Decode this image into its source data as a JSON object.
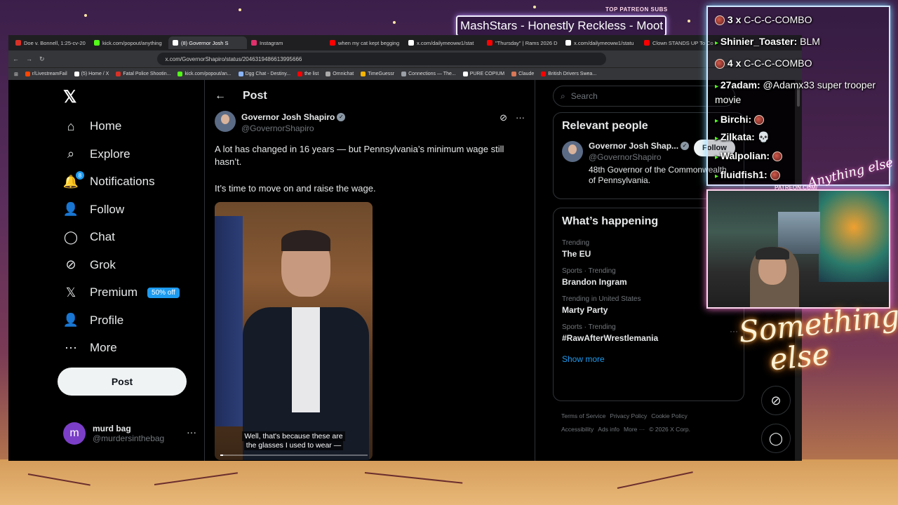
{
  "browser": {
    "tabs": [
      {
        "label": "Doe v. Bonnell, 1:25-cv-20",
        "color": "#d93025",
        "active": false
      },
      {
        "label": "kick.com/popout/anything",
        "color": "#53fc18",
        "active": false
      },
      {
        "label": "(8) Governor Josh S",
        "color": "#ffffff",
        "active": true
      },
      {
        "label": "Instagram",
        "color": "#e1306c",
        "active": false
      },
      {
        "label": "when my cat kept begging",
        "color": "#ff0000",
        "active": false
      },
      {
        "label": "x.com/dailymeoww1/stat",
        "color": "#ffffff",
        "active": false
      },
      {
        "label": "\"Thursday\" | Rams 2026 D",
        "color": "#ff0000",
        "active": false
      },
      {
        "label": "x.com/dailymeoww1/statu",
        "color": "#ffffff",
        "active": false
      },
      {
        "label": "Clown STANDS UP To Co",
        "color": "#ff0000",
        "active": false
      }
    ],
    "url": "x.com/GovernorShapiro/status/2046319486613995666",
    "bookmarks": [
      {
        "label": "r/LivestreamFail",
        "color": "#ff4500"
      },
      {
        "label": "(5) Home / X",
        "color": "#ffffff"
      },
      {
        "label": "Fatal Police Shootin...",
        "color": "#d93025"
      },
      {
        "label": "kick.com/popout/an...",
        "color": "#53fc18"
      },
      {
        "label": "Dgg Chat - Destiny...",
        "color": "#8ab4f8"
      },
      {
        "label": "the list",
        "color": "#ff0000"
      },
      {
        "label": "Omnichat",
        "color": "#aaaaaa"
      },
      {
        "label": "TimeGuessr",
        "color": "#f4b400"
      },
      {
        "label": "Connections — The...",
        "color": "#9aa0a6"
      },
      {
        "label": "PURE COPIUM",
        "color": "#ffffff"
      },
      {
        "label": "Claude",
        "color": "#d97757"
      },
      {
        "label": "British Drivers Swea...",
        "color": "#ff0000"
      }
    ]
  },
  "nav": {
    "items": [
      {
        "label": "Home",
        "icon": "home-icon",
        "glyph": "⌂"
      },
      {
        "label": "Explore",
        "icon": "search-icon",
        "glyph": "⌕"
      },
      {
        "label": "Notifications",
        "icon": "bell-icon",
        "glyph": "🔔",
        "badge": "8"
      },
      {
        "label": "Follow",
        "icon": "follow-icon",
        "glyph": "👤"
      },
      {
        "label": "Chat",
        "icon": "chat-icon",
        "glyph": "◯"
      },
      {
        "label": "Grok",
        "icon": "grok-icon",
        "glyph": "⊘"
      },
      {
        "label": "Premium",
        "icon": "x-icon",
        "glyph": "𝕏",
        "pill": "50% off"
      },
      {
        "label": "Profile",
        "icon": "profile-icon",
        "glyph": "👤"
      },
      {
        "label": "More",
        "icon": "more-icon",
        "glyph": "⋯"
      }
    ],
    "post_label": "Post",
    "account": {
      "avatar_letter": "m",
      "name": "murd bag",
      "handle": "@murdersinthebag"
    }
  },
  "post": {
    "header": "Post",
    "author_name": "Governor Josh Shapiro",
    "author_handle": "@GovernorShapiro",
    "text1": "A lot has changed in 16 years — but Pennsylvania’s minimum wage still hasn’t.",
    "text2": "It’s time to move on and raise the wage.",
    "caption_line1": "Well, that's because these are",
    "caption_line2": "the glasses I used to wear —",
    "progress": 0.02
  },
  "sidebar": {
    "search_placeholder": "Search",
    "relevant_title": "Relevant people",
    "relevant_name": "Governor Josh Shap...",
    "relevant_handle": "@GovernorShapiro",
    "relevant_bio": "48th Governor of the Commonwealth of Pennsylvania.",
    "follow_label": "Follow",
    "happening_title": "What’s happening",
    "trends": [
      {
        "meta": "Trending",
        "title": "The EU"
      },
      {
        "meta": "Sports · Trending",
        "title": "Brandon Ingram"
      },
      {
        "meta": "Trending in United States",
        "title": "Marty Party"
      },
      {
        "meta": "Sports · Trending",
        "title": "#RawAfterWrestlemania"
      }
    ],
    "show_more": "Show more",
    "footer_row1": [
      "Terms of Service",
      "Privacy Policy",
      "Cookie Policy"
    ],
    "footer_row2": [
      "Accessibility",
      "Ads info",
      "More ···",
      "© 2026 X Corp."
    ]
  },
  "overlay": {
    "top_patreon": "TOP PATREON SUBS",
    "now_playing": "MashStars - Honestly Reckless - Moot P",
    "patreon_link": "PATREON.COM/",
    "chat": [
      {
        "user": "3 x",
        "msg": "C-C-C-COMBO"
      },
      {
        "user": "Shinier_Toaster:",
        "msg": "BLM"
      },
      {
        "user": "4 x",
        "msg": "C-C-C-COMBO"
      },
      {
        "user": "27adam:",
        "msg": "@Adamx33 super trooper"
      },
      {
        "user": "",
        "msg": "movie"
      },
      {
        "user": "Birchi:",
        "msg": ""
      },
      {
        "user": "Zilkata:",
        "msg": "💀"
      },
      {
        "user": "Walpolian:",
        "msg": ""
      },
      {
        "user": "fluidfish1:",
        "msg": ""
      }
    ],
    "signature_line1": "Something",
    "signature_line2": "else",
    "signature_small": "Anything else"
  }
}
